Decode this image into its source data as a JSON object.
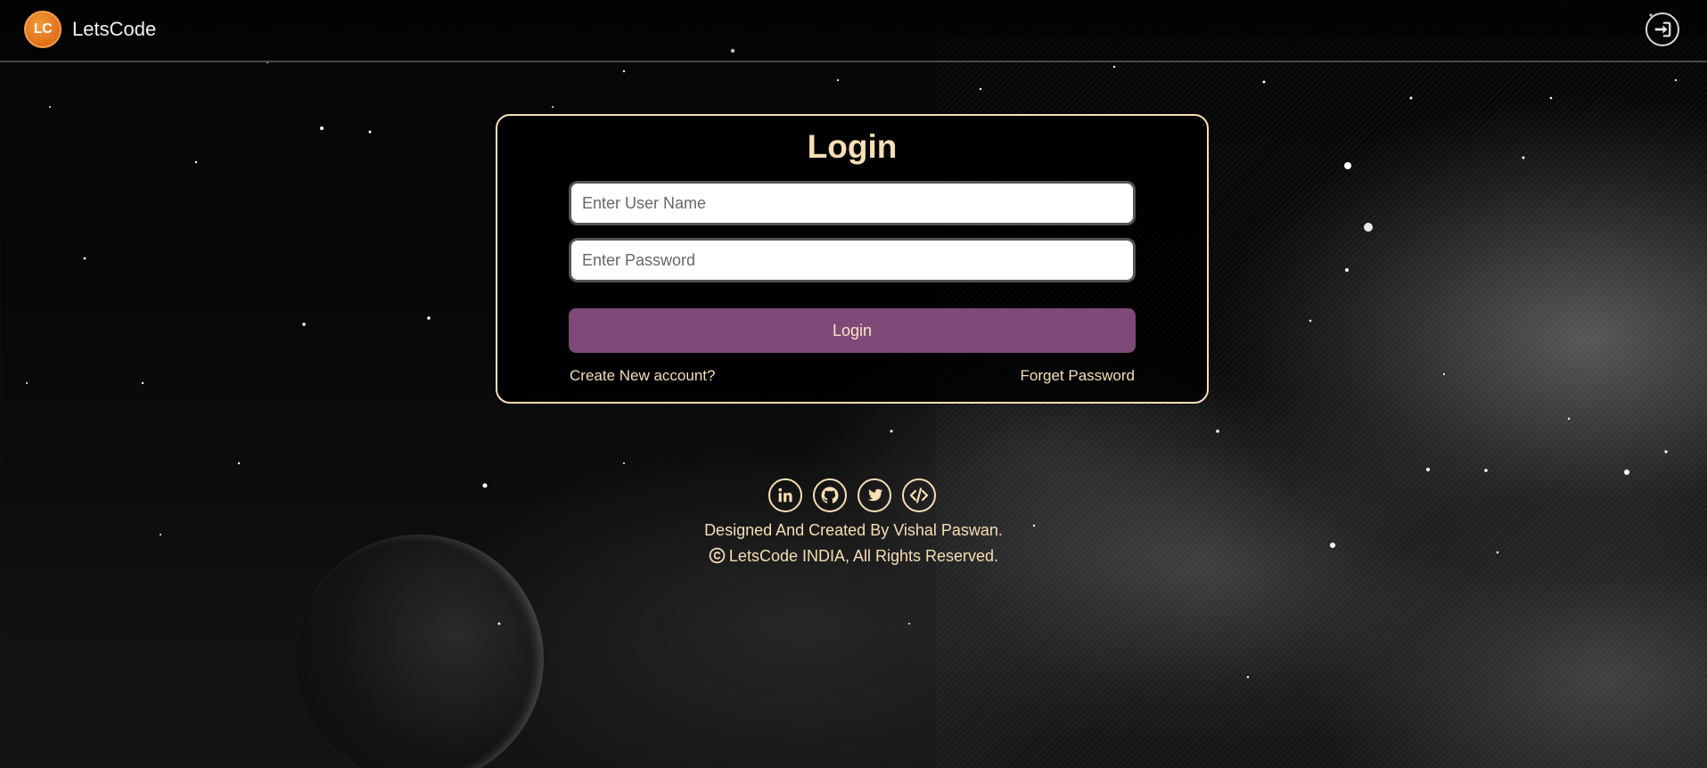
{
  "header": {
    "logo_text": "LC",
    "brand_name": "LetsCode",
    "login_icon": "sign-in-icon"
  },
  "login_form": {
    "title": "Login",
    "username_placeholder": "Enter User Name",
    "password_placeholder": "Enter Password",
    "submit_label": "Login",
    "create_account_link": "Create New account?",
    "forgot_password_link": "Forget Password"
  },
  "footer": {
    "social_icons": [
      "linkedin-icon",
      "github-icon",
      "twitter-icon",
      "code-icon"
    ],
    "credit": "Designed And Created By Vishal Paswan.",
    "copyright": "LetsCode INDIA, All Rights Reserved."
  },
  "colors": {
    "accent": "#f8dfb5",
    "button": "#7e4977",
    "logo": "#e0701a"
  }
}
